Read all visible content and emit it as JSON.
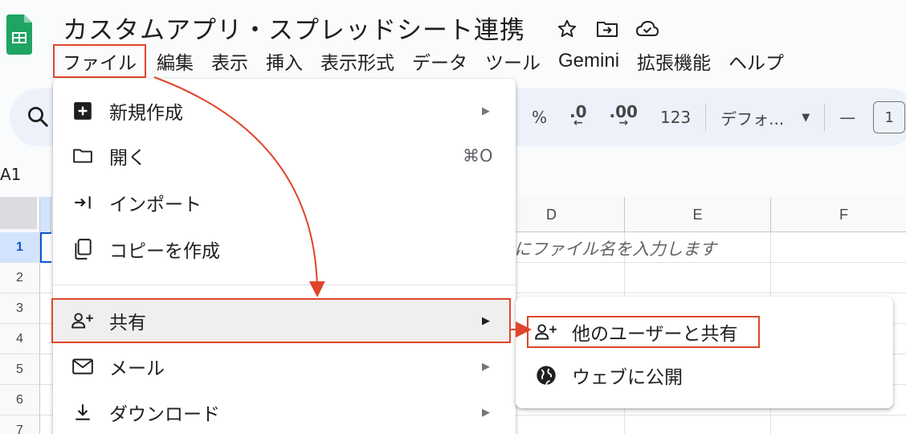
{
  "app": {
    "title": "カスタムアプリ・スプレッドシート連携",
    "icons": [
      "star-icon",
      "move-to-folder-icon",
      "cloud-saved-icon"
    ]
  },
  "menubar": {
    "items": [
      "ファイル",
      "編集",
      "表示",
      "挿入",
      "表示形式",
      "データ",
      "ツール",
      "Gemini",
      "拡張機能",
      "ヘルプ"
    ]
  },
  "toolbar": {
    "percent": "%",
    "decrease_decimal": ".0",
    "increase_decimal": ".00",
    "number_format": "123",
    "font": "デフォ...",
    "minus": "—",
    "font_size": "1"
  },
  "name_box": {
    "value": "A1"
  },
  "grid": {
    "columns": [
      "D",
      "E",
      "F"
    ],
    "rows": [
      "1",
      "2",
      "3",
      "4",
      "5",
      "6",
      "7"
    ],
    "cell_hint": "にファイル名を入力します"
  },
  "file_menu": {
    "items": [
      {
        "label": "新規作成",
        "icon": "new-sheet-icon",
        "has_submenu": true
      },
      {
        "label": "開く",
        "icon": "folder-icon",
        "shortcut": "⌘O"
      },
      {
        "label": "インポート",
        "icon": "import-icon"
      },
      {
        "label": "コピーを作成",
        "icon": "copy-icon"
      },
      {
        "label": "共有",
        "icon": "person-add-icon",
        "has_submenu": true,
        "highlighted": true
      },
      {
        "label": "メール",
        "icon": "mail-icon",
        "has_submenu": true
      },
      {
        "label": "ダウンロード",
        "icon": "download-icon",
        "has_submenu": true
      }
    ],
    "arrow": "▶"
  },
  "share_submenu": {
    "items": [
      {
        "label": "他のユーザーと共有",
        "icon": "person-add-icon",
        "highlighted": true
      },
      {
        "label": "ウェブに公開",
        "icon": "globe-icon"
      }
    ]
  },
  "colors": {
    "annotation": "#e0452c",
    "sheets_green": "#0f9d58",
    "selection_blue": "#0b57d0",
    "toolbar_bg": "#edf2fa"
  }
}
